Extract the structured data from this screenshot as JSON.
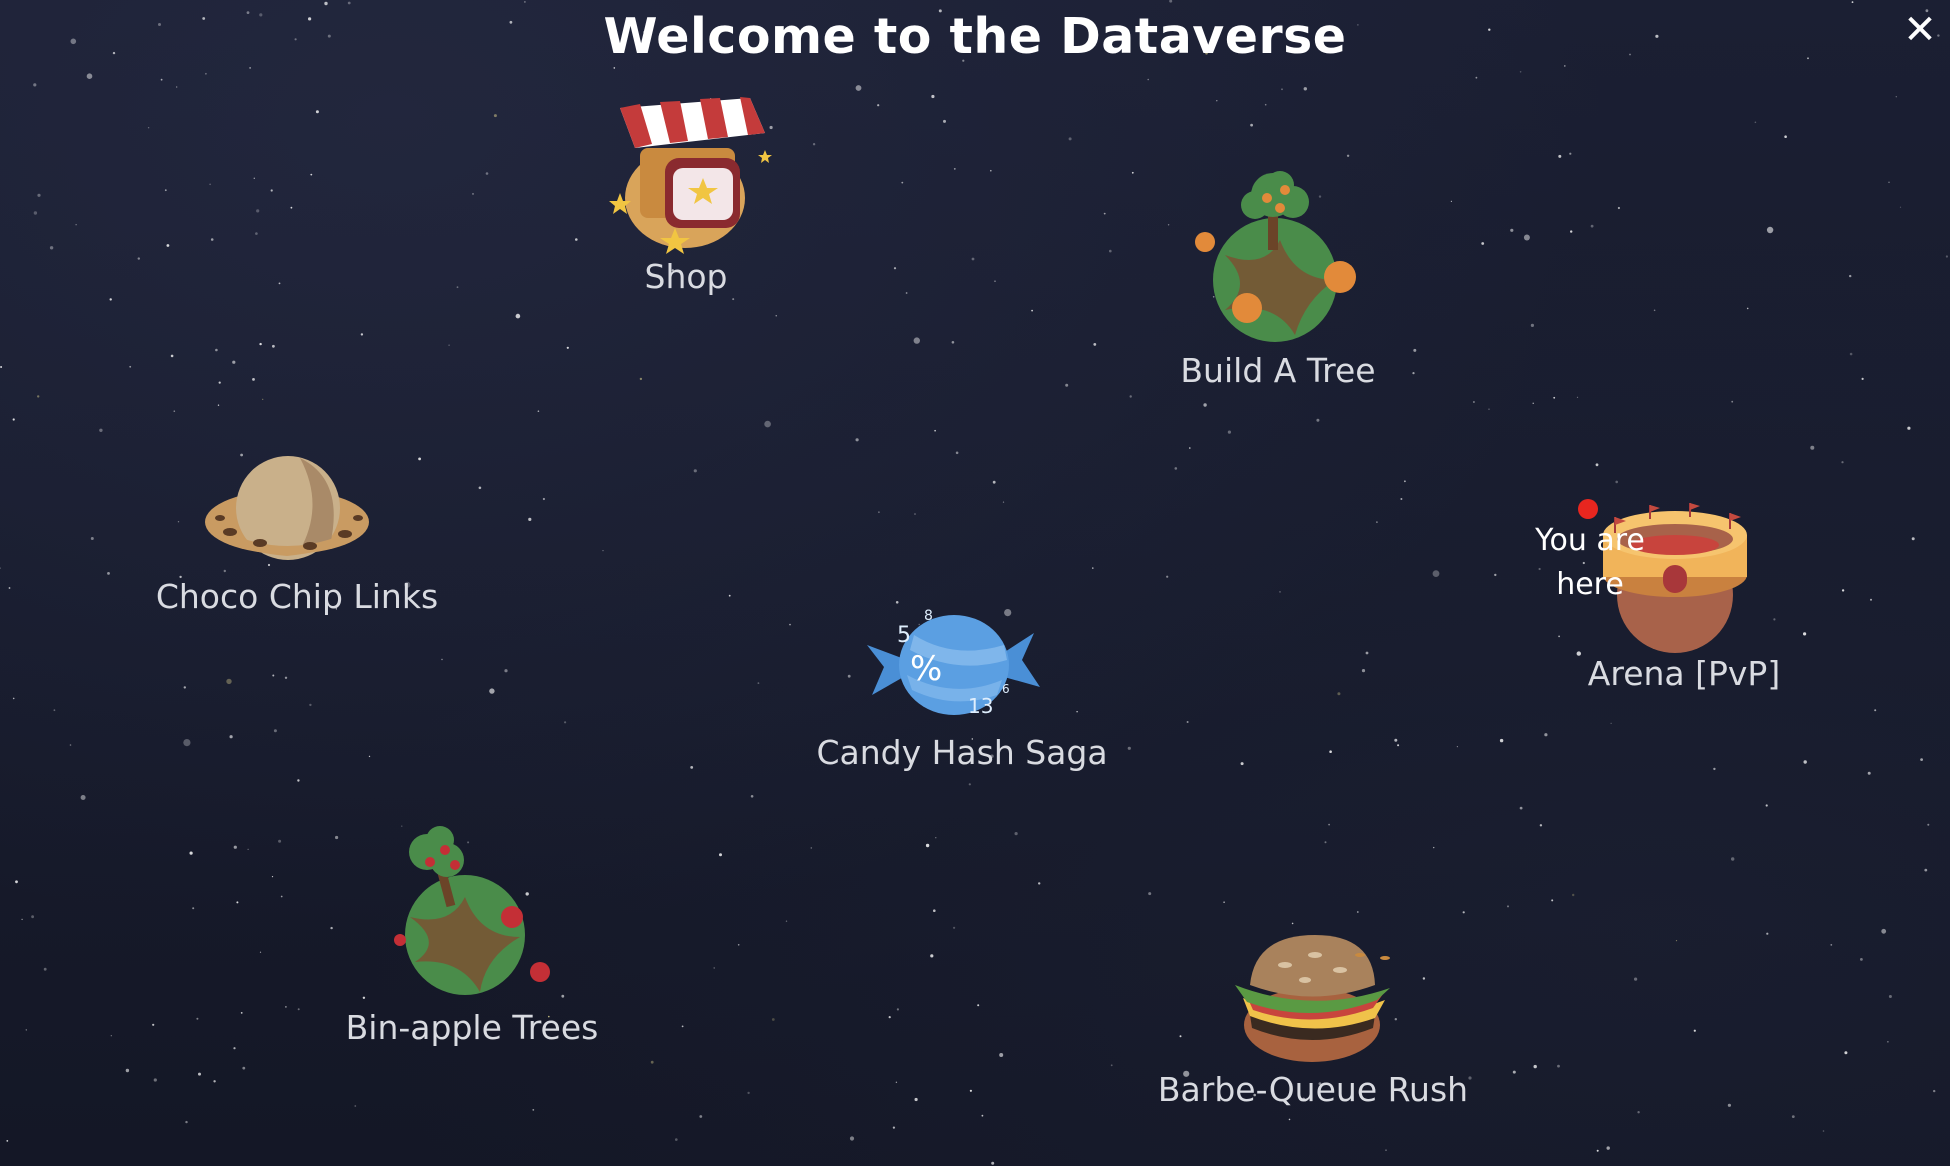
{
  "title": "Welcome to the Dataverse",
  "close_icon": "close-icon",
  "locations": {
    "shop": "Shop",
    "build_a_tree": "Build A Tree",
    "choco_chip_links": "Choco Chip Links",
    "arena": "Arena [PvP]",
    "candy_hash_saga": "Candy Hash Saga",
    "bin_apple_trees": "Bin-apple Trees",
    "barbe_queue_rush": "Barbe-Queue Rush"
  },
  "current_location_marker": {
    "line1": "You are",
    "line2": "here"
  },
  "candy_numbers": [
    "5",
    "8",
    "%",
    "13",
    "6"
  ],
  "colors": {
    "background": "#171b2c",
    "marker": "#e8261f",
    "label": "#d9dbe1"
  }
}
